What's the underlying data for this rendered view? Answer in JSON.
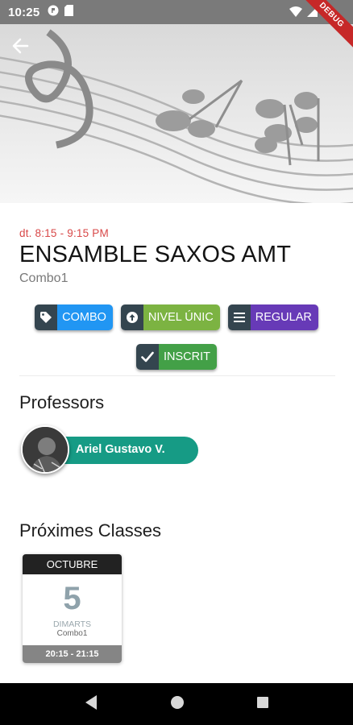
{
  "status_bar": {
    "time": "10:25",
    "debug_label": "DEBUG",
    "icons": [
      "app-circle-icon",
      "sim-card-icon",
      "wifi-icon",
      "signal-icon",
      "battery-icon"
    ]
  },
  "hero": {
    "image": "music-staff-notes-illustration",
    "back_icon": "back-arrow-icon"
  },
  "class_info": {
    "time": "dt. 8:15 - 9:15 PM",
    "title": "ENSAMBLE SAXOS AMT",
    "subtitle": "Combo1"
  },
  "tags": [
    {
      "label": "COMBO",
      "icon": "tag-icon",
      "color": "#2196f3"
    },
    {
      "label": "NIVEL ÚNIC",
      "icon": "arrow-up-circle-icon",
      "color": "#7cb342"
    },
    {
      "label": "REGULAR",
      "icon": "menu-lines-icon",
      "color": "#673ab7"
    },
    {
      "label": "INSCRIT",
      "icon": "check-icon",
      "color": "#43a047"
    }
  ],
  "professors": {
    "title": "Professors",
    "items": [
      {
        "name": "Ariel Gustavo V.",
        "color": "#169b85"
      }
    ]
  },
  "upcoming": {
    "title": "Próximes Classes",
    "items": [
      {
        "month": "OCTUBRE",
        "day": "5",
        "weekday": "DIMARTS",
        "group": "Combo1",
        "hours": "20:15 - 21:15"
      }
    ]
  },
  "nav_bar": {
    "icons": [
      "nav-back-icon",
      "nav-home-icon",
      "nav-recents-icon"
    ]
  },
  "colors": {
    "status_bar": "#7a7a7a",
    "accent_red": "#d84848",
    "tag_icon_bg": "#34454f"
  }
}
